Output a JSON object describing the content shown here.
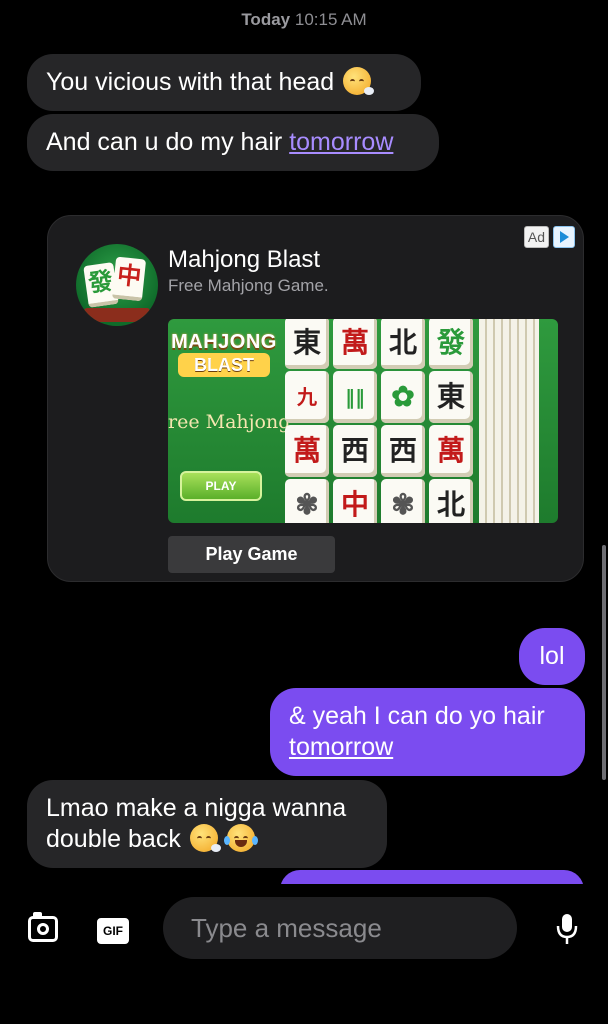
{
  "header": {
    "day": "Today",
    "time": "10:15 AM"
  },
  "messages": {
    "m1": {
      "text": "You vicious with that head"
    },
    "m2": {
      "text": "And can u do my hair ",
      "link": "tomorrow"
    },
    "m3": {
      "text": "lol"
    },
    "m4": {
      "line1": "& yeah I can do yo hair",
      "link": "tomorrow"
    },
    "m5": {
      "line1": "Lmao make a nigga wanna",
      "line2": "double back"
    }
  },
  "ad": {
    "badge": "Ad",
    "app_name": "Mahjong Blast",
    "subtitle": "Free Mahjong Game.",
    "icon_tiles": [
      "發",
      "中"
    ],
    "image": {
      "logo_line1": "MAHJONG",
      "logo_line2": "BLAST",
      "tagline": "ree Mahjong",
      "play_label": "PLAY",
      "tiles": [
        "東",
        "萬",
        "北",
        "發",
        "九",
        "萬",
        "東",
        "萬",
        "西",
        "西",
        "萬",
        "中",
        "北"
      ]
    },
    "cta": "Play Game"
  },
  "composer": {
    "placeholder": "Type a message",
    "gif_label": "GIF"
  },
  "icons": {
    "camera": "camera-icon",
    "gif": "gif-icon",
    "mic": "microphone-icon",
    "ad_choices": "adchoices-icon"
  },
  "colors": {
    "sent_bubble": "#7b4cf0",
    "received_bubble": "#262628",
    "background": "#000000"
  }
}
